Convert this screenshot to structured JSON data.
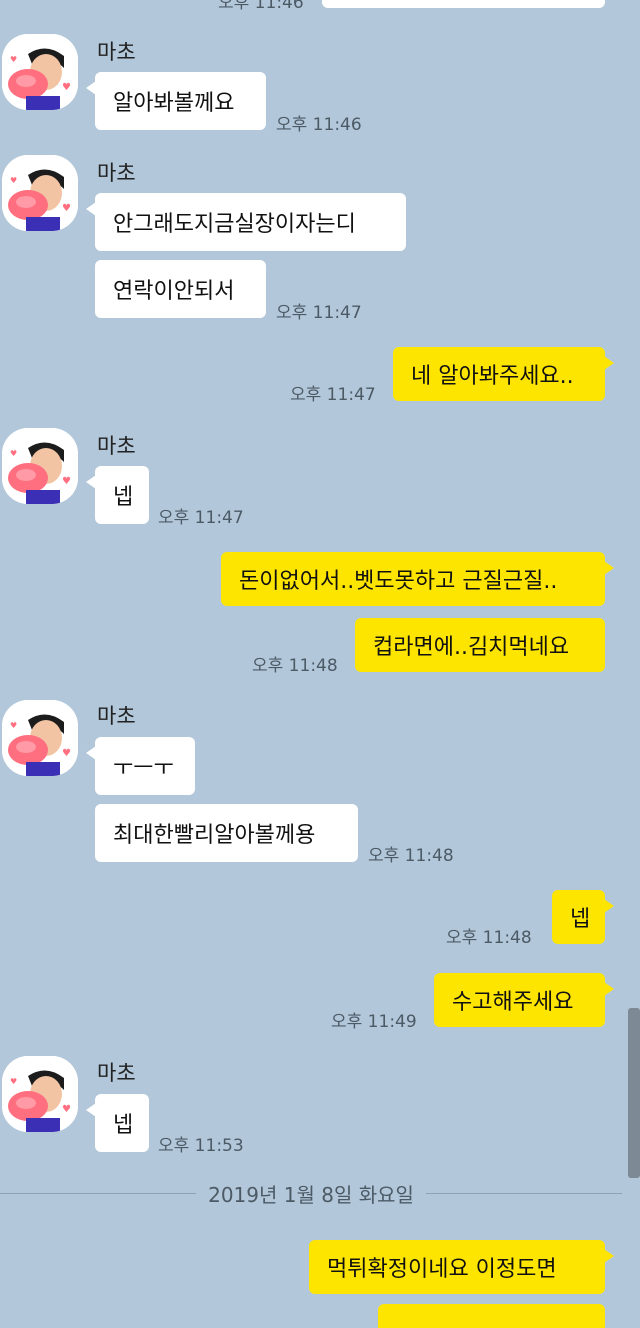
{
  "contact": {
    "name": "마초"
  },
  "top_partial": {
    "time": "오후 11:46"
  },
  "date_separator": "2019년 1월 8일 화요일",
  "messages": {
    "m1": {
      "text": "알아봐볼께요",
      "time": "오후 11:46"
    },
    "m2": {
      "text": "안그래도지금실장이자는디"
    },
    "m3": {
      "text": "연락이안되서",
      "time": "오후 11:47"
    },
    "m4": {
      "text": "네 알아봐주세요..",
      "time": "오후 11:47"
    },
    "m5": {
      "text": "넵",
      "time": "오후 11:47"
    },
    "m6": {
      "text": "돈이없어서..벳도못하고 근질근질.."
    },
    "m7": {
      "text": "컵라면에..김치먹네요",
      "time": "오후 11:48"
    },
    "m8": {
      "text": "ㅜㅡㅜ"
    },
    "m9": {
      "text": "최대한빨리알아볼께용",
      "time": "오후 11:48"
    },
    "m10": {
      "text": "넵",
      "time": "오후 11:48"
    },
    "m11": {
      "text": "수고해주세요",
      "time": "오후 11:49"
    },
    "m12": {
      "text": "넵",
      "time": "오후 11:53"
    },
    "m13": {
      "text": "먹튀확정이네요 이정도면"
    }
  },
  "colors": {
    "background": "#b2c7d9",
    "incoming_bubble": "#ffffff",
    "outgoing_bubble": "#fee500"
  }
}
